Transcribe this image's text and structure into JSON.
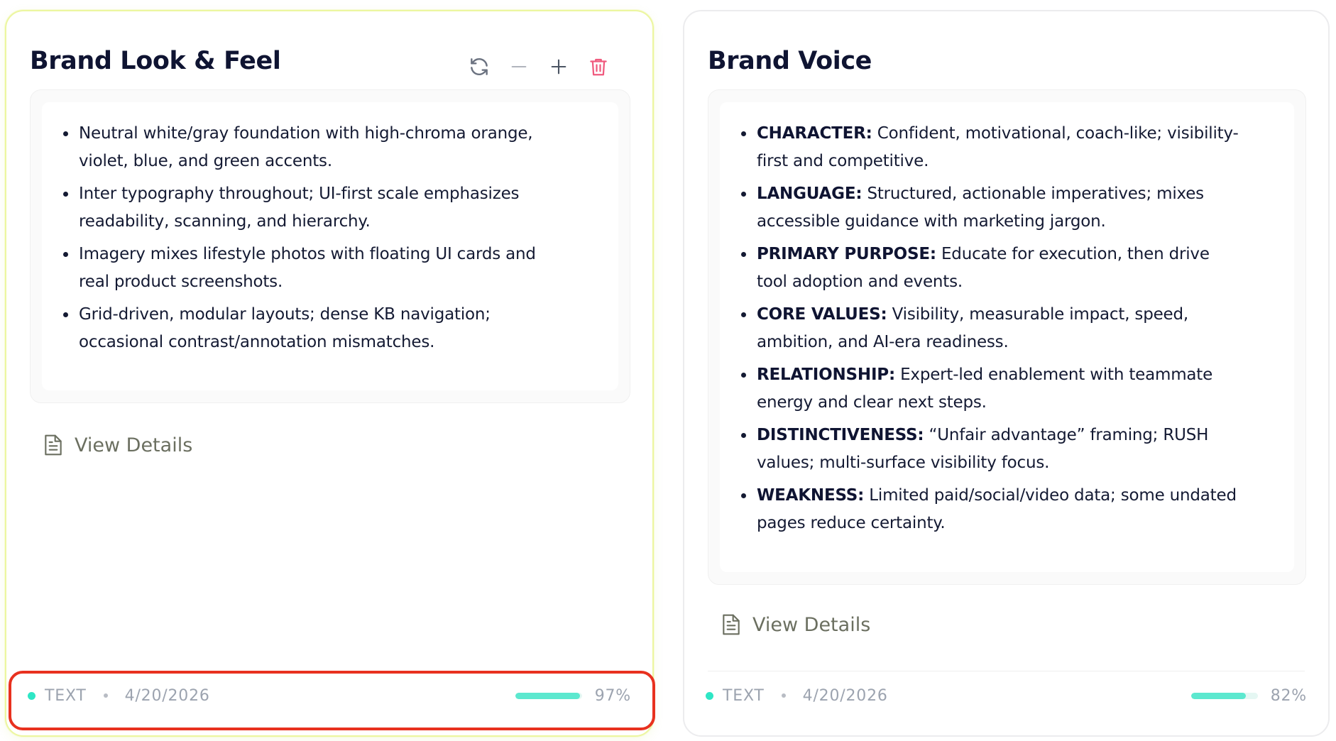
{
  "colors": {
    "accent_teal": "#2ee6c5",
    "progress_fill": "#5ce8cf",
    "delete_icon": "#f05a7e",
    "highlight_border": "#e8311f",
    "active_card_border": "#ecf6a0"
  },
  "cards": [
    {
      "title": "Brand Look & Feel",
      "actions": [
        "refresh-icon",
        "minus-icon",
        "plus-icon",
        "trash-icon"
      ],
      "bullets": [
        {
          "label": "",
          "text": "Neutral white/gray foundation with high-chroma orange, violet, blue, and green accents."
        },
        {
          "label": "",
          "text": "Inter typography throughout; UI-first scale emphasizes readability, scanning, and hierarchy."
        },
        {
          "label": "",
          "text": "Imagery mixes lifestyle photos with floating UI cards and real product screenshots."
        },
        {
          "label": "",
          "text": "Grid-driven, modular layouts; dense KB navigation; occasional contrast/annotation mismatches."
        }
      ],
      "view_details": "View Details",
      "footer": {
        "type": "TEXT",
        "date": "4/20/2026",
        "progress": 0.97,
        "progress_label": "97%"
      }
    },
    {
      "title": "Brand Voice",
      "bullets": [
        {
          "label": "CHARACTER:",
          "text": " Confident, motivational, coach-like; visibility-first and competitive."
        },
        {
          "label": "LANGUAGE:",
          "text": " Structured, actionable imperatives; mixes accessible guidance with marketing jargon."
        },
        {
          "label": "PRIMARY PURPOSE:",
          "text": " Educate for execution, then drive tool adoption and events."
        },
        {
          "label": "CORE VALUES:",
          "text": " Visibility, measurable impact, speed, ambition, and AI-era readiness."
        },
        {
          "label": "RELATIONSHIP:",
          "text": " Expert-led enablement with teammate energy and clear next steps."
        },
        {
          "label": "DISTINCTIVENESS:",
          "text": " “Unfair advantage” framing; RUSH values; multi-surface visibility focus."
        },
        {
          "label": "WEAKNESS:",
          "text": " Limited paid/social/video data; some undated pages reduce certainty."
        }
      ],
      "view_details": "View Details",
      "footer": {
        "type": "TEXT",
        "date": "4/20/2026",
        "progress": 0.82,
        "progress_label": "82%"
      }
    }
  ]
}
